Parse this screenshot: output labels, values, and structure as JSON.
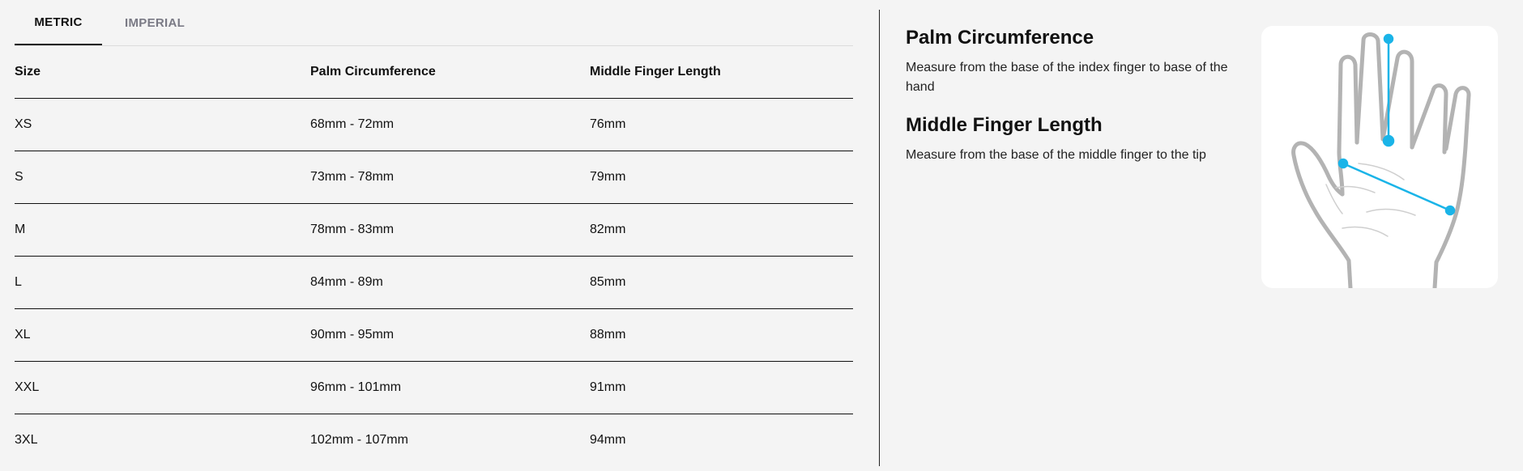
{
  "tabs": [
    {
      "label": "METRIC",
      "active": true
    },
    {
      "label": "IMPERIAL",
      "active": false
    }
  ],
  "table": {
    "headers": [
      "Size",
      "Palm Circumference",
      "Middle Finger Length"
    ],
    "rows": [
      [
        "XS",
        "68mm - 72mm",
        "76mm"
      ],
      [
        "S",
        "73mm - 78mm",
        "79mm"
      ],
      [
        "M",
        "78mm - 83mm",
        "82mm"
      ],
      [
        "L",
        "84mm - 89m",
        "85mm"
      ],
      [
        "XL",
        "90mm - 95mm",
        "88mm"
      ],
      [
        "XXL",
        "96mm - 101mm",
        "91mm"
      ],
      [
        "3XL",
        "102mm - 107mm",
        "94mm"
      ]
    ]
  },
  "guide": {
    "palm_title": "Palm Circumference",
    "palm_text": "Measure from the base of the index finger to base of the hand",
    "finger_title": "Middle Finger Length",
    "finger_text": "Measure from the base of the middle finger to the tip"
  },
  "colors": {
    "accent": "#1ab4e8",
    "hand_outline": "#b3b3b3"
  },
  "icons": {
    "hand_illustration": "hand-measurement-icon"
  }
}
